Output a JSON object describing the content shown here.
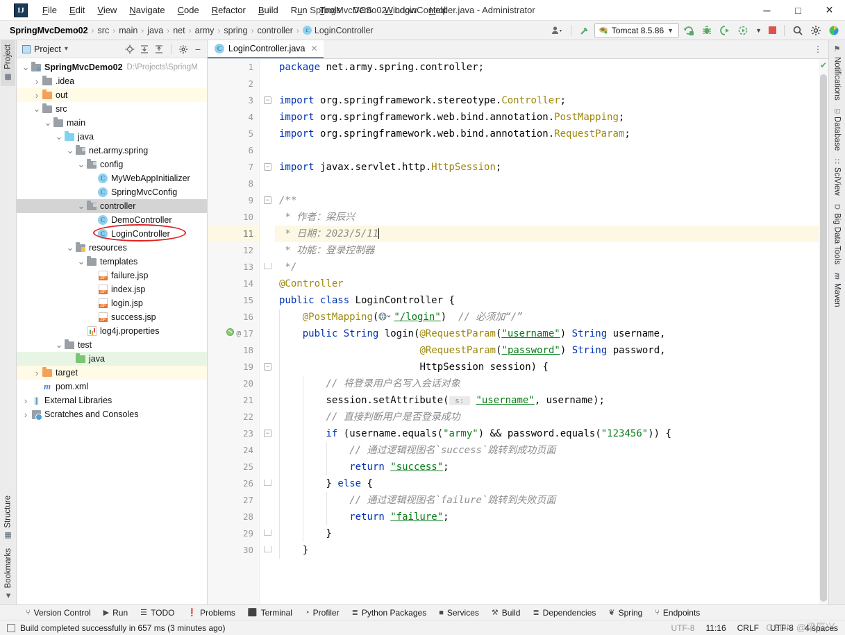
{
  "window": {
    "title": "SpringMvcDemo02 - LoginController.java - Administrator",
    "minimize": "─",
    "maximize": "□",
    "close": "✕",
    "logo": "IJ"
  },
  "menubar": {
    "items": [
      {
        "label": "File",
        "mnemonic": "F"
      },
      {
        "label": "Edit",
        "mnemonic": "E"
      },
      {
        "label": "View",
        "mnemonic": "V"
      },
      {
        "label": "Navigate",
        "mnemonic": "N"
      },
      {
        "label": "Code",
        "mnemonic": "C"
      },
      {
        "label": "Refactor",
        "mnemonic": "R"
      },
      {
        "label": "Build",
        "mnemonic": "B"
      },
      {
        "label": "Run",
        "mnemonic": "u"
      },
      {
        "label": "Tools",
        "mnemonic": "T"
      },
      {
        "label": "VCS",
        "mnemonic": ""
      },
      {
        "label": "Window",
        "mnemonic": "W"
      },
      {
        "label": "Help",
        "mnemonic": "H"
      }
    ]
  },
  "breadcrumb": {
    "items": [
      "SpringMvcDemo02",
      "src",
      "main",
      "java",
      "net",
      "army",
      "spring",
      "controller",
      "LoginController"
    ],
    "class_badge": "c",
    "separator": "›"
  },
  "toolbar": {
    "run_config": "Tomcat 8.5.86",
    "icons": [
      "user-avatar-icon",
      "hammer-build-icon",
      "tomcat-icon",
      "chevron-down-icon",
      "rerun-icon",
      "debug-icon",
      "run-with-coverage-icon",
      "profile-icon",
      "stop-icon",
      "search-everywhere-icon",
      "settings-gear-icon",
      "ide-assistant-icon"
    ]
  },
  "left_toolwindows": {
    "top": [
      {
        "label": "Project",
        "icon": "project-icon",
        "active": true
      }
    ],
    "bottom": [
      {
        "label": "Structure",
        "icon": "structure-icon"
      },
      {
        "label": "Bookmarks",
        "icon": "bookmark-icon"
      }
    ]
  },
  "right_toolwindows": [
    {
      "label": "Notifications",
      "icon": "bell-icon"
    },
    {
      "label": "Database",
      "icon": "database-icon"
    },
    {
      "label": "SciView",
      "icon": "sciview-icon"
    },
    {
      "label": "Big Data Tools",
      "icon": "big-data-tools-icon"
    },
    {
      "label": "Maven",
      "icon": "maven-icon"
    }
  ],
  "project_panel": {
    "title": "Project",
    "dropdown": "▾",
    "actions": [
      "locate-target-icon",
      "expand-all-icon",
      "collapse-all-icon",
      "settings-gear-icon",
      "hide-icon"
    ],
    "tree": [
      {
        "label": "SpringMvcDemo02",
        "sub": "D:\\Projects\\SpringM",
        "depth": 0,
        "arrow": "v",
        "icon": "module-folder-icon",
        "bold": true,
        "hl": ""
      },
      {
        "label": ".idea",
        "sub": "",
        "depth": 1,
        "arrow": ">",
        "icon": "folder-gray-icon",
        "bold": false,
        "hl": ""
      },
      {
        "label": "out",
        "sub": "",
        "depth": 1,
        "arrow": ">",
        "icon": "folder-orange-icon",
        "bold": false,
        "hl": "yellow"
      },
      {
        "label": "src",
        "sub": "",
        "depth": 1,
        "arrow": "v",
        "icon": "folder-gray-icon",
        "bold": false,
        "hl": ""
      },
      {
        "label": "main",
        "sub": "",
        "depth": 2,
        "arrow": "v",
        "icon": "folder-gray-icon",
        "bold": false,
        "hl": ""
      },
      {
        "label": "java",
        "sub": "",
        "depth": 3,
        "arrow": "v",
        "icon": "folder-source-icon",
        "bold": false,
        "hl": ""
      },
      {
        "label": "net.army.spring",
        "sub": "",
        "depth": 4,
        "arrow": "v",
        "icon": "package-icon",
        "bold": false,
        "hl": ""
      },
      {
        "label": "config",
        "sub": "",
        "depth": 5,
        "arrow": "v",
        "icon": "package-icon",
        "bold": false,
        "hl": ""
      },
      {
        "label": "MyWebAppInitializer",
        "sub": "",
        "depth": 6,
        "arrow": "",
        "icon": "java-class-icon",
        "bold": false,
        "hl": ""
      },
      {
        "label": "SpringMvcConfig",
        "sub": "",
        "depth": 6,
        "arrow": "",
        "icon": "java-class-icon",
        "bold": false,
        "hl": ""
      },
      {
        "label": "controller",
        "sub": "",
        "depth": 5,
        "arrow": "v",
        "icon": "package-icon",
        "bold": false,
        "hl": "selected"
      },
      {
        "label": "DemoController",
        "sub": "",
        "depth": 6,
        "arrow": "",
        "icon": "java-class-icon",
        "bold": false,
        "hl": ""
      },
      {
        "label": "LoginController",
        "sub": "",
        "depth": 6,
        "arrow": "",
        "icon": "java-class-icon",
        "bold": false,
        "hl": "circled"
      },
      {
        "label": "resources",
        "sub": "",
        "depth": 4,
        "arrow": "v",
        "icon": "folder-resources-icon",
        "bold": false,
        "hl": ""
      },
      {
        "label": "templates",
        "sub": "",
        "depth": 5,
        "arrow": "v",
        "icon": "folder-gray-icon",
        "bold": false,
        "hl": ""
      },
      {
        "label": "failure.jsp",
        "sub": "",
        "depth": 6,
        "arrow": "",
        "icon": "jsp-file-icon",
        "bold": false,
        "hl": ""
      },
      {
        "label": "index.jsp",
        "sub": "",
        "depth": 6,
        "arrow": "",
        "icon": "jsp-file-icon",
        "bold": false,
        "hl": ""
      },
      {
        "label": "login.jsp",
        "sub": "",
        "depth": 6,
        "arrow": "",
        "icon": "jsp-file-icon",
        "bold": false,
        "hl": ""
      },
      {
        "label": "success.jsp",
        "sub": "",
        "depth": 6,
        "arrow": "",
        "icon": "jsp-file-icon",
        "bold": false,
        "hl": ""
      },
      {
        "label": "log4j.properties",
        "sub": "",
        "depth": 5,
        "arrow": "",
        "icon": "properties-file-icon",
        "bold": false,
        "hl": ""
      },
      {
        "label": "test",
        "sub": "",
        "depth": 3,
        "arrow": "v",
        "icon": "folder-gray-icon",
        "bold": false,
        "hl": ""
      },
      {
        "label": "java",
        "sub": "",
        "depth": 4,
        "arrow": "",
        "icon": "folder-test-source-icon",
        "bold": false,
        "hl": "green"
      },
      {
        "label": "target",
        "sub": "",
        "depth": 1,
        "arrow": ">",
        "icon": "folder-orange-icon",
        "bold": false,
        "hl": "yellow"
      },
      {
        "label": "pom.xml",
        "sub": "",
        "depth": 1,
        "arrow": "",
        "icon": "maven-pom-icon",
        "bold": false,
        "hl": ""
      },
      {
        "label": "External Libraries",
        "sub": "",
        "depth": 0,
        "arrow": ">",
        "icon": "libraries-icon",
        "bold": false,
        "hl": ""
      },
      {
        "label": "Scratches and Consoles",
        "sub": "",
        "depth": 0,
        "arrow": ">",
        "icon": "scratches-icon",
        "bold": false,
        "hl": ""
      }
    ]
  },
  "editor": {
    "tab": {
      "label": "LoginController.java",
      "icon": "java-class-icon",
      "close": "✕"
    },
    "current_line": 11,
    "inspection_status": "ok-check-icon",
    "gutter_icons_line17": [
      "spring-bean-icon",
      "annotation-icon"
    ],
    "lines": [
      {
        "n": 1,
        "fold": "",
        "text": "package net.army.spring.controller;"
      },
      {
        "n": 2,
        "fold": "",
        "text": ""
      },
      {
        "n": 3,
        "fold": "minus",
        "text": "import org.springframework.stereotype.Controller;"
      },
      {
        "n": 4,
        "fold": "",
        "text": "import org.springframework.web.bind.annotation.PostMapping;"
      },
      {
        "n": 5,
        "fold": "",
        "text": "import org.springframework.web.bind.annotation.RequestParam;"
      },
      {
        "n": 6,
        "fold": "",
        "text": ""
      },
      {
        "n": 7,
        "fold": "minus",
        "text": "import javax.servlet.http.HttpSession;"
      },
      {
        "n": 8,
        "fold": "",
        "text": ""
      },
      {
        "n": 9,
        "fold": "minus",
        "text": "/**"
      },
      {
        "n": 10,
        "fold": "",
        "text": " * 作者：梁辰兴"
      },
      {
        "n": 11,
        "fold": "",
        "text": " * 日期：2023/5/11"
      },
      {
        "n": 12,
        "fold": "",
        "text": " * 功能：登录控制器"
      },
      {
        "n": 13,
        "fold": "end",
        "text": " */"
      },
      {
        "n": 14,
        "fold": "",
        "text": "@Controller"
      },
      {
        "n": 15,
        "fold": "",
        "text": "public class LoginController {"
      },
      {
        "n": 16,
        "fold": "",
        "text": "    @PostMapping(\"/login\")  // 必须加“/”"
      },
      {
        "n": 17,
        "fold": "",
        "text": "    public String login(@RequestParam(\"username\") String username,"
      },
      {
        "n": 18,
        "fold": "",
        "text": "                        @RequestParam(\"password\") String password,"
      },
      {
        "n": 19,
        "fold": "minus",
        "text": "                        HttpSession session) {"
      },
      {
        "n": 20,
        "fold": "",
        "text": "        // 将登录用户名写入会话对象"
      },
      {
        "n": 21,
        "fold": "",
        "text": "        session.setAttribute( s: \"username\", username);"
      },
      {
        "n": 22,
        "fold": "",
        "text": "        // 直接判断用户是否登录成功"
      },
      {
        "n": 23,
        "fold": "minus",
        "text": "        if (username.equals(\"army\") && password.equals(\"123456\")) {"
      },
      {
        "n": 24,
        "fold": "",
        "text": "            // 通过逻辑视图名`success`跳转到成功页面"
      },
      {
        "n": 25,
        "fold": "",
        "text": "            return \"success\";"
      },
      {
        "n": 26,
        "fold": "end",
        "text": "        } else {"
      },
      {
        "n": 27,
        "fold": "",
        "text": "            // 通过逻辑视图名`failure`跳转到失败页面"
      },
      {
        "n": 28,
        "fold": "",
        "text": "            return \"failure\";"
      },
      {
        "n": 29,
        "fold": "end",
        "text": "        }"
      },
      {
        "n": 30,
        "fold": "end",
        "text": "    }"
      }
    ]
  },
  "bottom_toolwindows": [
    {
      "label": "Version Control",
      "icon": "branch-icon"
    },
    {
      "label": "Run",
      "icon": "play-icon"
    },
    {
      "label": "TODO",
      "icon": "todo-list-icon"
    },
    {
      "label": "Problems",
      "icon": "problems-icon"
    },
    {
      "label": "Terminal",
      "icon": "terminal-icon"
    },
    {
      "label": "Profiler",
      "icon": "profiler-icon"
    },
    {
      "label": "Python Packages",
      "icon": "python-packages-icon"
    },
    {
      "label": "Services",
      "icon": "services-icon"
    },
    {
      "label": "Build",
      "icon": "hammer-build-icon"
    },
    {
      "label": "Dependencies",
      "icon": "dependencies-icon"
    },
    {
      "label": "Spring",
      "icon": "spring-leaf-icon"
    },
    {
      "label": "Endpoints",
      "icon": "endpoints-icon"
    }
  ],
  "statusbar": {
    "message": "Build completed successfully in 657 ms (3 minutes ago)",
    "message_icon": "build-status-icon",
    "encoding_left": "UTF-8",
    "caret_position": "11:16",
    "line_separator": "CRLF",
    "file_encoding": "UTF-8",
    "indent": "4 spaces",
    "watermark": "CSDN @梁辰兴"
  },
  "colors": {
    "accent_blue": "#4a90d9",
    "keyword": "#0033b3",
    "string": "#067d17",
    "annotation": "#9e880d",
    "comment": "#8c8c8c",
    "highlight_circle": "#e02020",
    "ok_green": "#59a869"
  }
}
